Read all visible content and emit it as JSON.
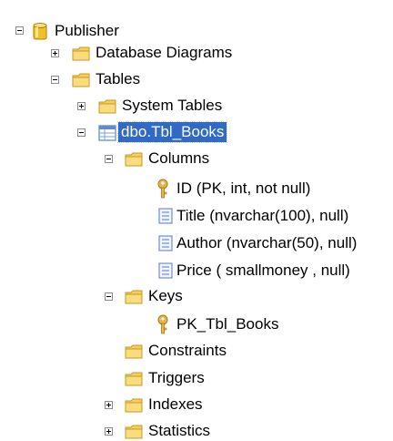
{
  "tree": {
    "root": {
      "label": "Publisher",
      "icon": "database-icon",
      "state": "expanded"
    },
    "items": [
      {
        "id": "database-diagrams",
        "label": "Database Diagrams",
        "icon": "folder-icon",
        "state": "collapsed"
      },
      {
        "id": "tables",
        "label": "Tables",
        "icon": "folder-icon",
        "state": "expanded"
      },
      {
        "id": "system-tables",
        "label": "System Tables",
        "icon": "folder-icon",
        "state": "collapsed"
      },
      {
        "id": "tbl-books",
        "label": "dbo.Tbl_Books",
        "icon": "table-icon",
        "state": "expanded",
        "selected": true
      },
      {
        "id": "columns",
        "label": "Columns",
        "icon": "folder-icon",
        "state": "expanded"
      },
      {
        "id": "col-id",
        "label": "ID (PK, int, not null)",
        "icon": "key-icon"
      },
      {
        "id": "col-title",
        "label": "Title (nvarchar(100), null)",
        "icon": "column-icon"
      },
      {
        "id": "col-author",
        "label": "Author (nvarchar(50), null)",
        "icon": "column-icon"
      },
      {
        "id": "col-price",
        "label": "Price ( smallmoney , null)",
        "icon": "column-icon"
      },
      {
        "id": "keys",
        "label": "Keys",
        "icon": "folder-icon",
        "state": "expanded"
      },
      {
        "id": "pk-tbl-books",
        "label": "PK_Tbl_Books",
        "icon": "key-icon"
      },
      {
        "id": "constraints",
        "label": "Constraints",
        "icon": "folder-icon"
      },
      {
        "id": "triggers",
        "label": "Triggers",
        "icon": "folder-icon"
      },
      {
        "id": "indexes",
        "label": "Indexes",
        "icon": "folder-icon",
        "state": "collapsed"
      },
      {
        "id": "statistics",
        "label": "Statistics",
        "icon": "folder-icon",
        "state": "collapsed"
      }
    ]
  },
  "colors": {
    "selection": "#316ac5",
    "folder": "#f5cf5c",
    "database": "#f0c02a",
    "table": "#5b8ad6",
    "key": "#e8b54a"
  }
}
